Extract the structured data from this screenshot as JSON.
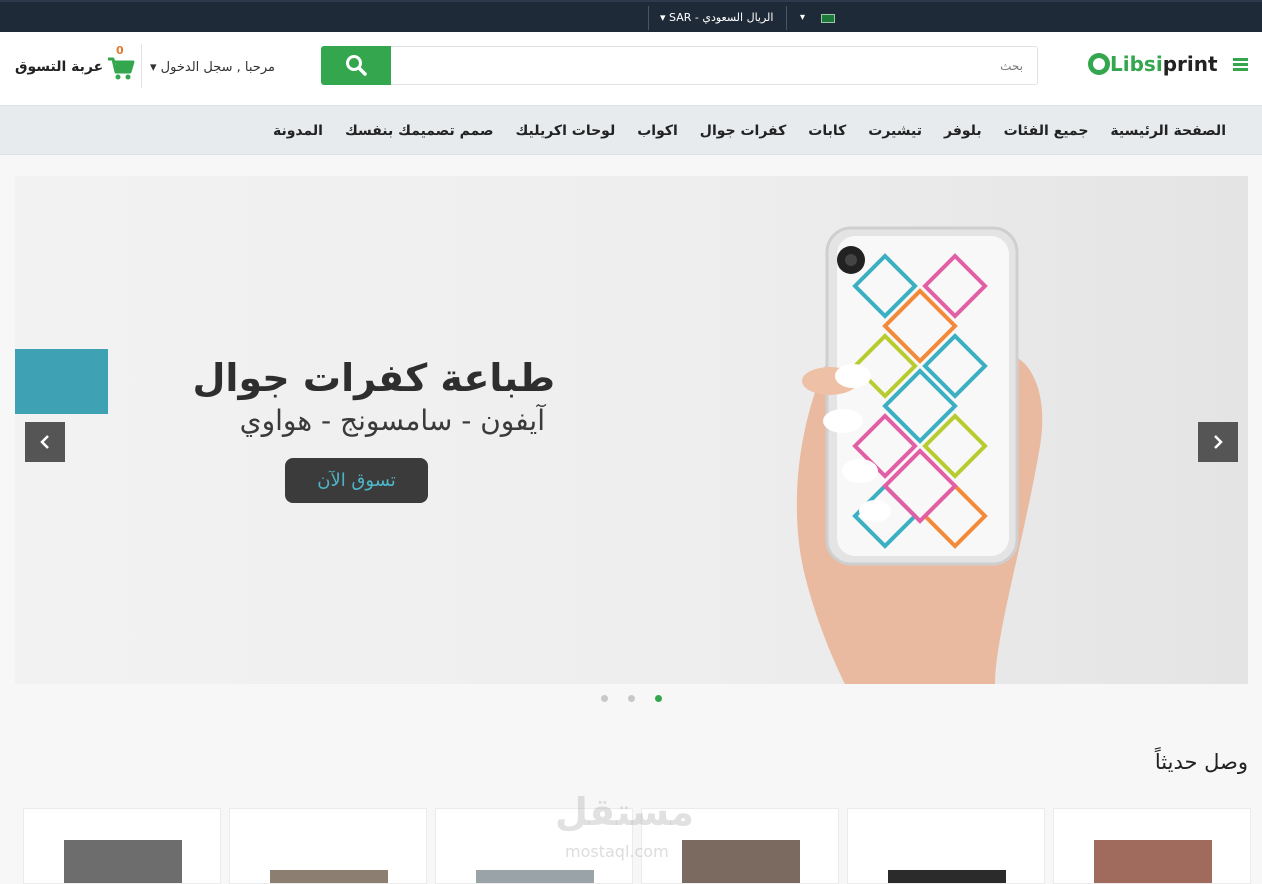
{
  "topbar": {
    "currency_label": "SAR - الريال السعودي",
    "currency_caret": "▾",
    "language_caret": "▾",
    "flag_color": "#1b7a3a"
  },
  "header": {
    "cart_label": "عربة التسوق",
    "cart_count": "0",
    "login_text": "مرحبا , سجل الدخول",
    "login_caret": "▾",
    "search_placeholder": "بحث",
    "logo_part1": "Libsi",
    "logo_part2": "print",
    "accent_color": "#33a64e"
  },
  "nav": {
    "items": [
      "الصفحة الرئيسية",
      "جميع الفئات",
      "بلوفر",
      "تيشيرت",
      "كابات",
      "كفرات جوال",
      "اكواب",
      "لوحات اكريليك",
      "صمم تصميمك بنفسك",
      "المدونة"
    ]
  },
  "hero": {
    "title": "طباعة كفرات جوال",
    "subtitle": "آيفون - سامسونج - هواوي",
    "cta": "تسوق الآن",
    "slide_count": 3,
    "active_slide": 3
  },
  "new_arrivals": {
    "title": "وصل حديثاً",
    "cards": [
      "product-1",
      "product-2",
      "product-3",
      "product-4",
      "product-5",
      "product-6"
    ]
  },
  "watermark": {
    "text_ar": "مستقل",
    "text_en": "mostaql.com"
  }
}
